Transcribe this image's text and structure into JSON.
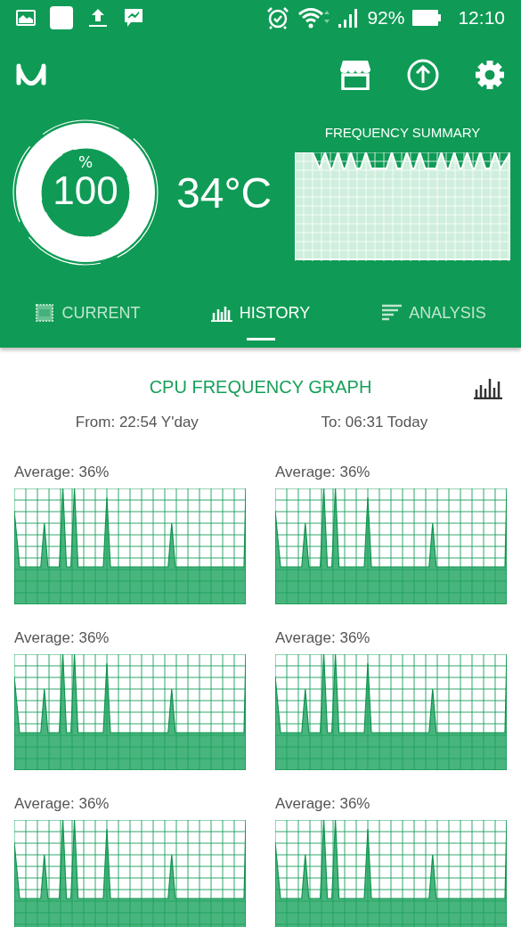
{
  "status_bar": {
    "battery": "92%",
    "time": "12:10"
  },
  "summary": {
    "gauge": {
      "unit": "%",
      "value": "100"
    },
    "temperature": "34°C",
    "frequency_summary": {
      "title": "FREQUENCY SUMMARY"
    }
  },
  "tabs": [
    {
      "kind": "cpu",
      "label": "CURRENT",
      "selected": false
    },
    {
      "kind": "bars",
      "label": "HISTORY",
      "selected": true
    },
    {
      "kind": "lines",
      "label": "ANALYSIS",
      "selected": false
    }
  ],
  "graph_section": {
    "title": "CPU FREQUENCY GRAPH",
    "from": "From: 22:54 Y'day",
    "to": "To: 06:31 Today"
  },
  "graphs": [
    {
      "label": "Average: 36%"
    },
    {
      "label": "Average: 36%"
    },
    {
      "label": "Average: 36%"
    },
    {
      "label": "Average: 36%"
    },
    {
      "label": "Average: 36%"
    },
    {
      "label": "Average: 36%"
    }
  ]
}
